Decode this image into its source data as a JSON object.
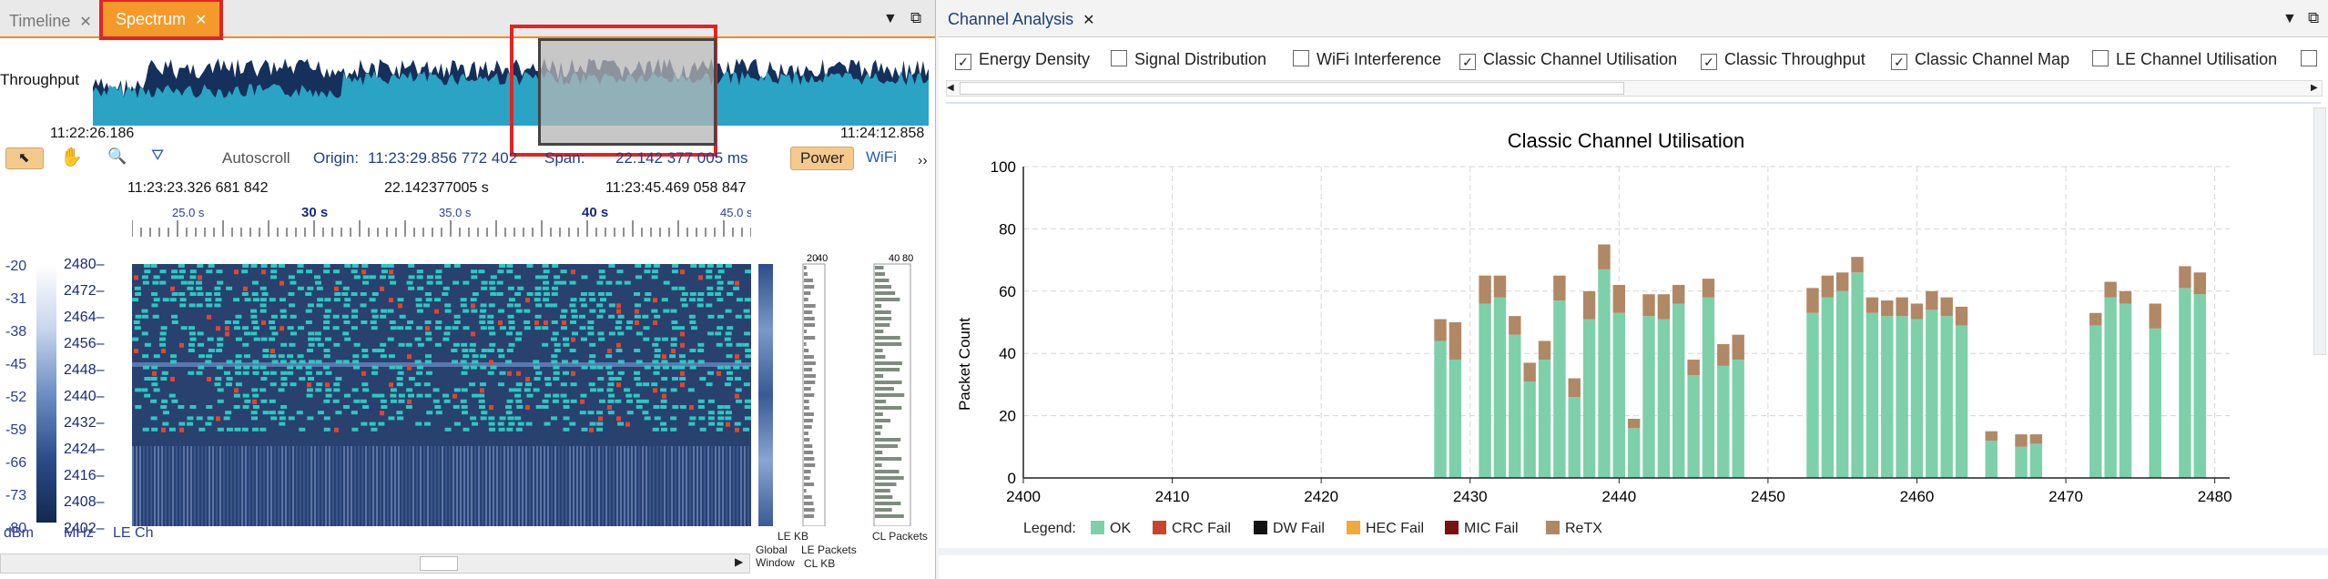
{
  "left": {
    "tabs": [
      {
        "label": "Timeline",
        "active": false
      },
      {
        "label": "Spectrum",
        "active": true
      }
    ],
    "throughput_label": "Throughput",
    "overview_start": "11:22:26.186",
    "overview_end": "11:24:12.858",
    "toolbar": {
      "autoscroll": "Autoscroll",
      "origin_label": "Origin:",
      "origin_value": "11:23:29.856 772 402",
      "span_label": "Span:",
      "span_value": "22.142 377 005 ms",
      "power_button": "Power",
      "wifi_button": "WiFi",
      "more": "››"
    },
    "time_ruler": {
      "start": "11:23:23.326 681 842",
      "span": "22.142377005 s",
      "end": "11:23:45.469 058 847",
      "ticks": [
        "25.0 s",
        "30 s",
        "35.0 s",
        "40 s",
        "45.0 s"
      ]
    },
    "dbm_scale": [
      "-20",
      "-31",
      "-38",
      "-45",
      "-52",
      "-59",
      "-66",
      "-73",
      "-80"
    ],
    "dbm_unit": "dBm",
    "mhz_scale": [
      "2480–",
      "2472–",
      "2464–",
      "2456–",
      "2448–",
      "2440–",
      "2432–",
      "2424–",
      "2416–",
      "2408–",
      "2402–"
    ],
    "mhz_unit": "MHz",
    "le_ch_label": "LE Ch",
    "side_panels": {
      "global_window": "Global Window",
      "le_kb": "LE KB",
      "cl_kb": "CL KB",
      "le_packets": "LE Packets",
      "cl_packets": "CL Packets",
      "kb_ticks": [
        "20",
        "40"
      ],
      "packet_ticks": [
        "40",
        "80"
      ]
    }
  },
  "right": {
    "tab_label": "Channel Analysis",
    "checkboxes": [
      {
        "label": "Energy Density",
        "checked": true
      },
      {
        "label": "Signal Distribution",
        "checked": false
      },
      {
        "label": "WiFi Interference",
        "checked": false
      },
      {
        "label": "Classic Channel Utilisation",
        "checked": true
      },
      {
        "label": "Classic Throughput",
        "checked": true
      },
      {
        "label": "Classic Channel Map",
        "checked": true
      },
      {
        "label": "LE Channel Utilisation",
        "checked": false
      }
    ],
    "check_glyph": "✓"
  },
  "chart_data": {
    "type": "bar",
    "title": "Classic Channel Utilisation",
    "xlabel": "",
    "ylabel": "Packet Count",
    "xlim": [
      2400,
      2481
    ],
    "ylim": [
      0,
      100
    ],
    "x_ticks": [
      "2400",
      "2410",
      "2420",
      "2430",
      "2440",
      "2450",
      "2460",
      "2470",
      "2480"
    ],
    "y_ticks": [
      "0",
      "20",
      "40",
      "60",
      "80",
      "100"
    ],
    "grid": true,
    "stacked": true,
    "x": [
      2428,
      2429,
      2431,
      2432,
      2433,
      2434,
      2435,
      2436,
      2437,
      2438,
      2439,
      2440,
      2441,
      2442,
      2443,
      2444,
      2445,
      2446,
      2447,
      2448,
      2453,
      2454,
      2455,
      2456,
      2457,
      2458,
      2459,
      2460,
      2461,
      2462,
      2463,
      2465,
      2467,
      2468,
      2472,
      2473,
      2474,
      2476,
      2478,
      2479
    ],
    "series": [
      {
        "name": "OK",
        "color": "#7ed0aa",
        "values": [
          44,
          38,
          56,
          58,
          46,
          31,
          38,
          57,
          26,
          51,
          67,
          53,
          16,
          52,
          51,
          56,
          33,
          58,
          36,
          38,
          53,
          58,
          60,
          66,
          53,
          52,
          52,
          51,
          54,
          52,
          49,
          12,
          10,
          11,
          49,
          58,
          56,
          48,
          61,
          59
        ],
        "tops_note": ""
      },
      {
        "name": "CRC Fail",
        "color": "#c8452c",
        "values": []
      },
      {
        "name": "DW Fail",
        "color": "#111111",
        "values": []
      },
      {
        "name": "HEC Fail",
        "color": "#f2a93b",
        "values": []
      },
      {
        "name": "MIC Fail",
        "color": "#7a1010",
        "values": []
      },
      {
        "name": "ReTX",
        "color": "#b08866",
        "values": [
          7,
          12,
          9,
          7,
          6,
          6,
          6,
          8,
          6,
          9,
          8,
          9,
          3,
          7,
          8,
          6,
          5,
          6,
          7,
          8,
          8,
          7,
          6,
          5,
          5,
          5,
          6,
          5,
          6,
          6,
          6,
          3,
          4,
          3,
          4,
          5,
          4,
          8,
          7,
          7
        ]
      }
    ],
    "legend": {
      "label": "Legend:",
      "position": "bottom-left",
      "items": [
        "OK",
        "CRC Fail",
        "DW Fail",
        "HEC Fail",
        "MIC Fail",
        "ReTX"
      ]
    }
  }
}
